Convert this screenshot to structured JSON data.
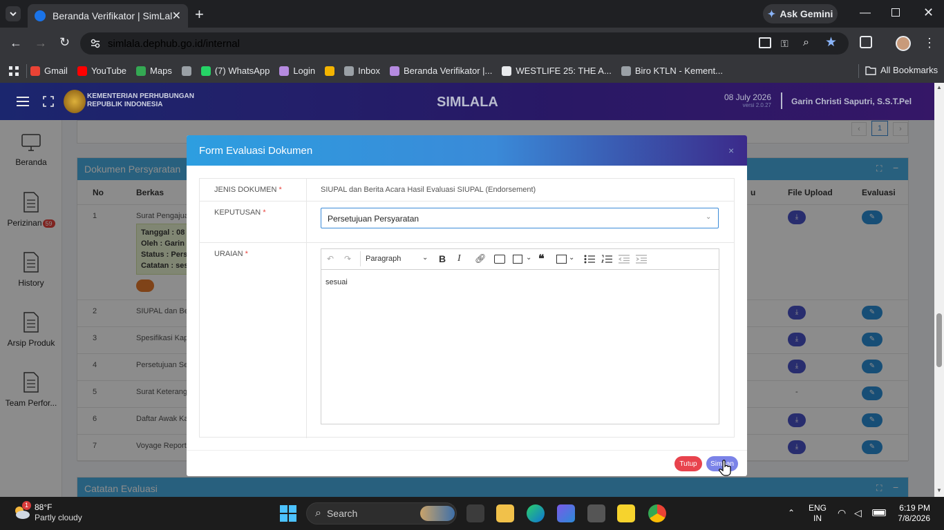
{
  "browser": {
    "tab_title": "Beranda Verifikator | SimLala",
    "url": "simlala.dephub.go.id/internal",
    "ask_gemini": "Ask Gemini",
    "bookmarks": [
      {
        "label": "Gmail",
        "color": "#ea4335"
      },
      {
        "label": "YouTube",
        "color": "#ff0000"
      },
      {
        "label": "Maps",
        "color": "#34a853"
      },
      {
        "label": "",
        "color": "#9aa0a6"
      },
      {
        "label": "(7) WhatsApp",
        "color": "#25d366"
      },
      {
        "label": "Login",
        "color": "#b58ae0"
      },
      {
        "label": "",
        "color": "#f4b400"
      },
      {
        "label": "Inbox",
        "color": "#9aa0a6"
      },
      {
        "label": "Beranda Verifikator |...",
        "color": "#b58ae0"
      },
      {
        "label": "WESTLIFE 25: THE A...",
        "color": "#e8eaed"
      },
      {
        "label": "Biro KTLN - Kement...",
        "color": "#9aa0a6"
      }
    ],
    "all_bookmarks": "All Bookmarks"
  },
  "app": {
    "org_line1": "KEMENTERIAN PERHUBUNGAN",
    "org_line2": "REPUBLIK INDONESIA",
    "title": "SIMLALA",
    "date": "08 July 2026",
    "version": "versi 2.0.27",
    "user": "Garin Christi Saputri, S.S.T.Pel"
  },
  "sidebar": {
    "items": [
      {
        "label": "Beranda",
        "badge": ""
      },
      {
        "label": "Perizinan",
        "badge": "59"
      },
      {
        "label": "History",
        "badge": ""
      },
      {
        "label": "Arsip Produk",
        "badge": ""
      },
      {
        "label": "Team Perfor...",
        "badge": ""
      }
    ]
  },
  "background": {
    "pagination": "1",
    "section1_title": "Dokumen Persyaratan",
    "section2_title": "Catatan Evaluasi",
    "columns": {
      "no": "No",
      "berkas": "Berkas",
      "u": "u",
      "file_upload": "File Upload",
      "evaluasi": "Evaluasi"
    },
    "note": {
      "tanggal": "Tanggal : 08",
      "oleh": "Oleh : Garin",
      "status": "Status : Perse",
      "catatan": "Catatan : ses"
    },
    "rows": [
      {
        "no": "1",
        "berkas": "Surat Pengajuan",
        "file": "download"
      },
      {
        "no": "2",
        "berkas": "SIUPAL dan Beri",
        "file": "download"
      },
      {
        "no": "3",
        "berkas": "Spesifikasi Kapa",
        "file": "download"
      },
      {
        "no": "4",
        "berkas": "Persetujuan Seb",
        "file": "download"
      },
      {
        "no": "5",
        "berkas": "Surat Keterangan",
        "file": "-"
      },
      {
        "no": "6",
        "berkas": "Daftar Awak Kap",
        "file": "download"
      },
      {
        "no": "7",
        "berkas": "Voyage Report (",
        "file": "download"
      }
    ]
  },
  "modal": {
    "title": "Form Evaluasi Dokumen",
    "close": "×",
    "jenis_label": "JENIS DOKUMEN",
    "jenis_value": "SIUPAL dan Berita Acara Hasil Evaluasi SIUPAL (Endorsement)",
    "keputusan_label": "KEPUTUSAN",
    "keputusan_value": "Persetujuan Persyaratan",
    "uraian_label": "URAIAN",
    "editor_format": "Paragraph",
    "editor_content": "sesuai",
    "required_mark": "*",
    "btn_tutup": "Tutup",
    "btn_simpan": "Simpan"
  },
  "taskbar": {
    "weather_temp": "88°F",
    "weather_desc": "Partly cloudy",
    "weather_badge": "1",
    "search_placeholder": "Search",
    "lang1": "ENG",
    "lang2": "IN",
    "time": "6:19 PM",
    "date": "7/8/2026"
  }
}
